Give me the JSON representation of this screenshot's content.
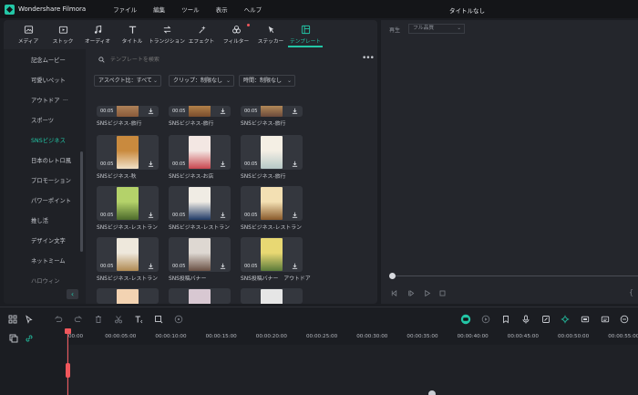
{
  "app": {
    "name": "Wondershare Filmora",
    "window_title": "タイトルなし",
    "menus": [
      "ファイル",
      "編集",
      "ツール",
      "表示",
      "ヘルプ"
    ]
  },
  "toolbar": {
    "tabs": [
      {
        "label": "メディア",
        "icon": "media-icon"
      },
      {
        "label": "ストック",
        "icon": "stock-icon"
      },
      {
        "label": "オーディオ",
        "icon": "audio-icon"
      },
      {
        "label": "タイトル",
        "icon": "title-icon"
      },
      {
        "label": "トランジション",
        "icon": "transition-icon"
      },
      {
        "label": "エフェクト",
        "icon": "effect-icon"
      },
      {
        "label": "フィルター",
        "icon": "filter-icon"
      },
      {
        "label": "ステッカー",
        "icon": "sticker-icon"
      },
      {
        "label": "テンプレート",
        "icon": "template-icon"
      }
    ],
    "active_tab": "テンプレート",
    "accent": "#23c6a6"
  },
  "sidebar": {
    "items": [
      "記念ムービー",
      "可愛いペット",
      "アウトドア",
      "スポーツ",
      "SNSビジネス",
      "日本のレトロ風",
      "プロモーション",
      "パワーポイント",
      "推し活",
      "デザイン文字",
      "ネットミーム",
      "ハロウィン"
    ],
    "active": "SNSビジネス"
  },
  "search": {
    "placeholder": "テンプレートを検索"
  },
  "filters": [
    {
      "label": "アスペクト比：すべて"
    },
    {
      "label": "クリップ：制限なし"
    },
    {
      "label": "時間：制限なし"
    }
  ],
  "templates": [
    {
      "label": "SNSビジネス-旅行",
      "duration": "00:05",
      "colors": [
        "#c49a6c",
        "#8a5a3a"
      ]
    },
    {
      "label": "SNSビジネス-旅行",
      "duration": "00:05",
      "colors": [
        "#d7a35b",
        "#7a4d2d"
      ]
    },
    {
      "label": "SNSビジネス-旅行",
      "duration": "00:05",
      "colors": [
        "#e0b26a",
        "#6b4a3b"
      ]
    },
    {
      "label": "SNSビジネス-秋",
      "duration": "00:05",
      "colors": [
        "#c98a3e",
        "#f1e1c8"
      ]
    },
    {
      "label": "SNSビジネス-お店",
      "duration": "00:05",
      "colors": [
        "#f3e7e3",
        "#c8474f"
      ]
    },
    {
      "label": "SNSビジネス-旅行",
      "duration": "00:05",
      "colors": [
        "#f4efe4",
        "#b6c8c7"
      ]
    },
    {
      "label": "SNSビジネス-レストラン",
      "duration": "00:05",
      "colors": [
        "#b4d26a",
        "#4c6a2b"
      ]
    },
    {
      "label": "SNSビジネス-レストラン",
      "duration": "00:05",
      "colors": [
        "#f0ece4",
        "#1f3a66"
      ]
    },
    {
      "label": "SNSビジネス-レストラン",
      "duration": "00:05",
      "colors": [
        "#f3e0b3",
        "#8a5a2b"
      ]
    },
    {
      "label": "SNSビジネス-レストラン",
      "duration": "00:05",
      "colors": [
        "#eee8dc",
        "#b08a52"
      ]
    },
    {
      "label": "SNS投稿バナー",
      "duration": "00:05",
      "colors": [
        "#ded8d2",
        "#6a5044"
      ]
    },
    {
      "label": "SNS投稿バナー　アウトドア",
      "duration": "00:05",
      "colors": [
        "#e8d873",
        "#5a7a3a"
      ]
    },
    {
      "label": "",
      "duration": "00:05",
      "colors": [
        "#f3d3b2",
        "#c84438"
      ]
    },
    {
      "label": "",
      "duration": "00:05",
      "colors": [
        "#d8c8d2",
        "#8a6a78"
      ]
    },
    {
      "label": "",
      "duration": "00:05",
      "colors": [
        "#e6e6e6",
        "#9bb8c8"
      ]
    }
  ],
  "preview": {
    "play_label": "再生",
    "quality": "フル品質"
  },
  "timeline": {
    "ticks": [
      "00:00",
      "00:00:05:00",
      "00:00:10:00",
      "00:00:15:00",
      "00:00:20:00",
      "00:00:25:00",
      "00:00:30:00",
      "00:00:35:00",
      "00:00:40:00",
      "00:00:45:00",
      "00:00:50:00",
      "00:00:55:00"
    ],
    "playhead_color": "#f0575c"
  }
}
